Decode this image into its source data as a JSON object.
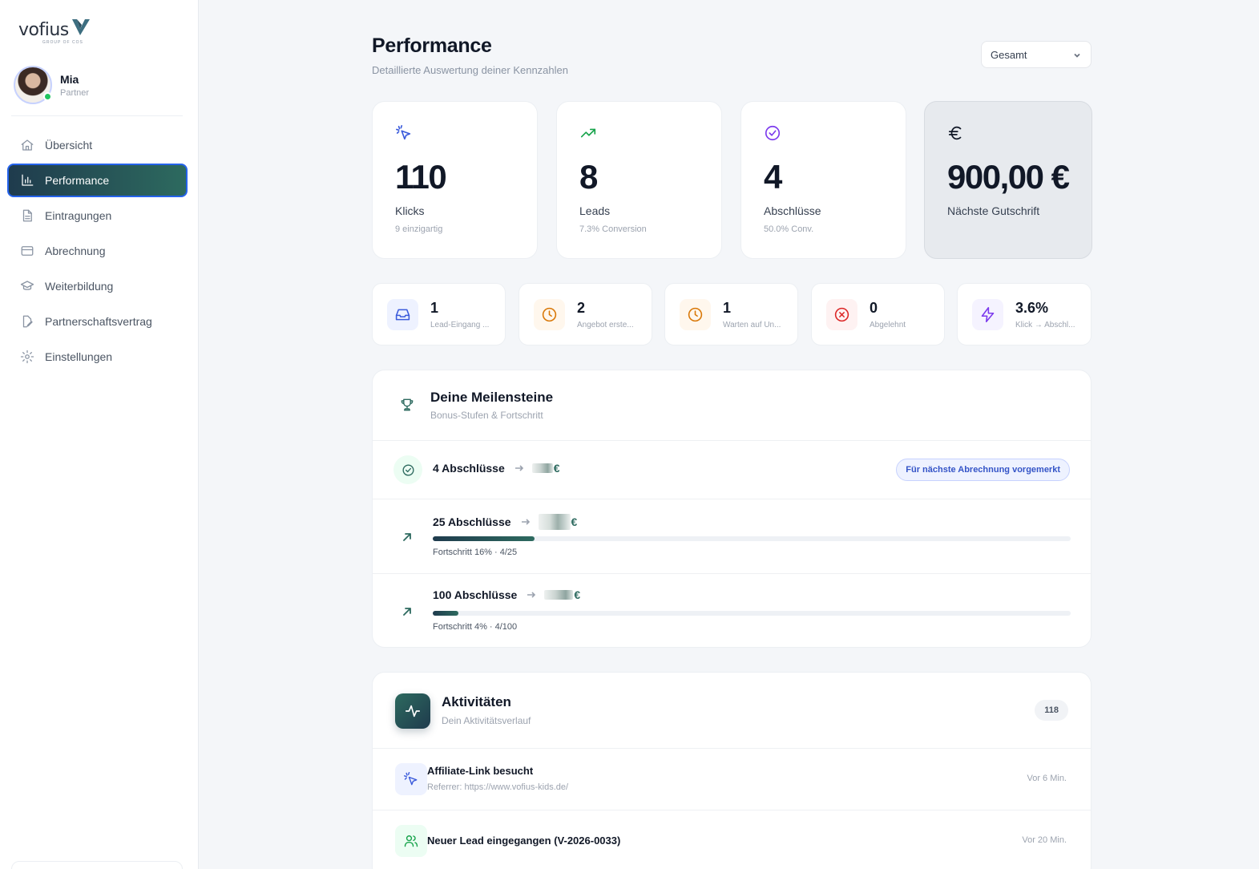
{
  "brand": {
    "name": "vofius",
    "tagline": "GROUP OF COS"
  },
  "user": {
    "name": "Mia",
    "role": "Partner"
  },
  "sidebar": {
    "items": [
      {
        "label": "Übersicht",
        "icon": "home-icon"
      },
      {
        "label": "Performance",
        "icon": "bar-chart-icon",
        "active": true
      },
      {
        "label": "Eintragungen",
        "icon": "document-icon"
      },
      {
        "label": "Abrechnung",
        "icon": "credit-card-icon"
      },
      {
        "label": "Weiterbildung",
        "icon": "graduation-cap-icon"
      },
      {
        "label": "Partnerschaftsvertrag",
        "icon": "file-edit-icon"
      },
      {
        "label": "Einstellungen",
        "icon": "gear-icon"
      }
    ]
  },
  "header": {
    "title": "Performance",
    "subtitle": "Detaillierte Auswertung deiner Kennzahlen",
    "period": "Gesamt"
  },
  "kpis": [
    {
      "icon": "cursor-click-icon",
      "value": "110",
      "label": "Klicks",
      "sub": "9 einzigartig",
      "color": "#3b5bdb"
    },
    {
      "icon": "trending-up-icon",
      "value": "8",
      "label": "Leads",
      "sub": "7.3% Conversion",
      "color": "#16a34a"
    },
    {
      "icon": "check-circle-icon",
      "value": "4",
      "label": "Abschlüsse",
      "sub": "50.0% Conv.",
      "color": "#7c3aed"
    },
    {
      "icon": "euro-icon",
      "value": "900,00 €",
      "label": "Nächste Gutschrift",
      "sub": "",
      "color": "#111827"
    }
  ],
  "stats": [
    {
      "icon": "inbox-icon",
      "value": "1",
      "label": "Lead-Eingang ...",
      "color": "#3b5bdb",
      "bg": "#eef2ff"
    },
    {
      "icon": "clock-icon",
      "value": "2",
      "label": "Angebot erste...",
      "color": "#d97706",
      "bg": "#fff7ed"
    },
    {
      "icon": "clock-icon",
      "value": "1",
      "label": "Warten auf Un...",
      "color": "#d97706",
      "bg": "#fff7ed"
    },
    {
      "icon": "x-circle-icon",
      "value": "0",
      "label": "Abgelehnt",
      "color": "#dc2626",
      "bg": "#fef2f2"
    },
    {
      "icon": "lightning-icon",
      "value": "3.6%",
      "label": "Klick → Abschl...",
      "color": "#7c3aed",
      "bg": "#f5f3ff"
    }
  ],
  "milestones": {
    "title": "Deine Meilensteine",
    "subtitle": "Bonus-Stufen & Fortschritt",
    "items": [
      {
        "goal": "4 Abschlüsse",
        "currency": "€",
        "status": "done",
        "badge": "Für nächste Abrechnung vorgemerkt"
      },
      {
        "goal": "25 Abschlüsse",
        "currency": "€",
        "status": "progress",
        "progress": 0.16,
        "progress_text": "Fortschritt 16% · 4/25"
      },
      {
        "goal": "100 Abschlüsse",
        "currency": "€",
        "status": "progress",
        "progress": 0.04,
        "progress_text": "Fortschritt 4% · 4/100"
      }
    ]
  },
  "activities": {
    "title": "Aktivitäten",
    "subtitle": "Dein Aktivitätsverlauf",
    "count": "118",
    "items": [
      {
        "icon": "cursor-click-icon",
        "title": "Affiliate-Link besucht",
        "sub": "Referrer: https://www.vofius-kids.de/",
        "time": "Vor 6 Min.",
        "color": "#3b5bdb",
        "bg": "#eef2ff"
      },
      {
        "icon": "users-icon",
        "title": "Neuer Lead eingegangen (V-2026-0033)",
        "sub": "",
        "time": "Vor 20 Min.",
        "color": "#16a34a",
        "bg": "#ecfdf3"
      }
    ]
  }
}
